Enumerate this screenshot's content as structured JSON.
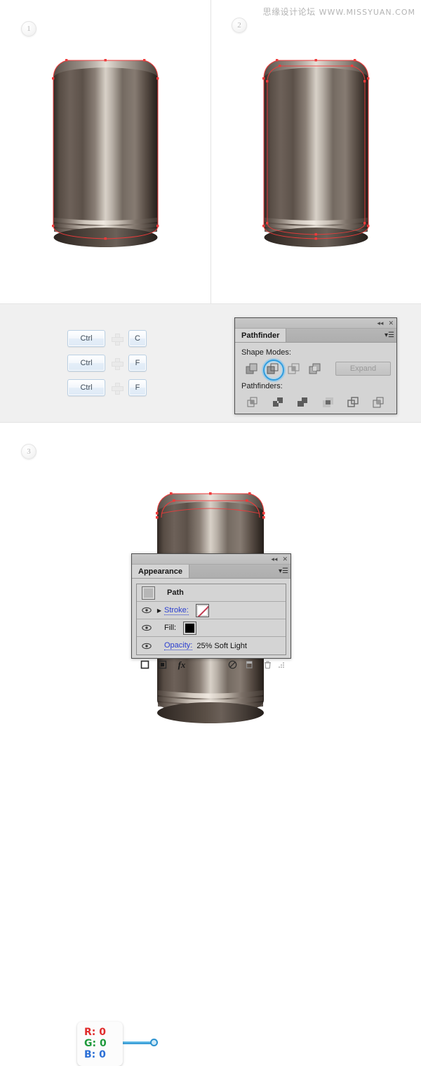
{
  "watermark": {
    "cn": "思缘设计论坛",
    "url": "WWW.MISSYUAN.COM"
  },
  "steps": [
    {
      "badge": "1"
    },
    {
      "badge": "2"
    },
    {
      "badge": "3"
    }
  ],
  "shortcuts": {
    "rows": [
      {
        "modifier": "Ctrl",
        "plus": "+",
        "key": "C"
      },
      {
        "modifier": "Ctrl",
        "plus": "+",
        "key": "F"
      },
      {
        "modifier": "Ctrl",
        "plus": "+",
        "key": "F"
      }
    ]
  },
  "pathfinder": {
    "title": "Pathfinder",
    "collapse_icon": "◂◂",
    "close_icon": "✕",
    "menu_icon": "▾☰",
    "shape_modes_label": "Shape Modes:",
    "pathfinders_label": "Pathfinders:",
    "expand_label": "Expand",
    "shape_modes": [
      {
        "name": "unite",
        "selected": false
      },
      {
        "name": "minus-front",
        "selected": true
      },
      {
        "name": "intersect",
        "selected": false
      },
      {
        "name": "exclude",
        "selected": false
      }
    ],
    "pathfinders": [
      {
        "name": "divide"
      },
      {
        "name": "trim"
      },
      {
        "name": "merge"
      },
      {
        "name": "crop"
      },
      {
        "name": "outline"
      },
      {
        "name": "minus-back"
      }
    ],
    "selection_color": "#2f9de0"
  },
  "appearance": {
    "title": "Appearance",
    "collapse_icon": "◂◂",
    "close_icon": "✕",
    "menu_icon": "▾☰",
    "object_label": "Path",
    "rows": [
      {
        "label": "Stroke:",
        "value": "",
        "swatch": "none",
        "eye": true,
        "arrow": true
      },
      {
        "label": "Fill:",
        "value": "",
        "swatch": "#000000",
        "eye": true,
        "arrow": false
      },
      {
        "label": "Opacity:",
        "value": "25% Soft Light",
        "swatch": "",
        "eye": true,
        "arrow": false
      }
    ],
    "footer_buttons": [
      {
        "name": "add-new-stroke",
        "glyph": "□"
      },
      {
        "name": "add-new-fill",
        "glyph": "■"
      },
      {
        "name": "add-new-effect",
        "glyph": "fx"
      },
      {
        "name": "clear-appearance",
        "glyph": "⊘"
      },
      {
        "name": "duplicate-item",
        "glyph": "❐"
      },
      {
        "name": "delete-item",
        "glyph": "Ὕ1"
      }
    ]
  },
  "rgb_callout": {
    "r_label": "R: 0",
    "g_label": "G: 0",
    "b_label": "B: 0",
    "r_color": "#e02b2b",
    "g_color": "#1f9a3c",
    "b_color": "#2b6fd6"
  },
  "artwork": {
    "description": "metallic cylinder with red vector path anchor points",
    "path_color": "#ef3b3b",
    "metal_light": "#e9e3dc",
    "metal_dark": "#3a322c"
  }
}
